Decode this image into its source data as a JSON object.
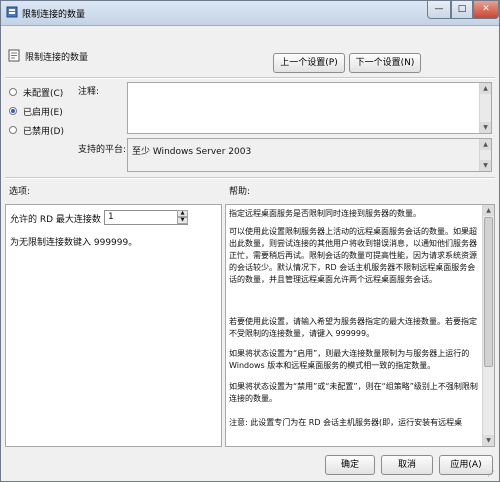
{
  "window": {
    "title": "限制连接的数量",
    "controls": {
      "minimize": "—",
      "maximize": "□",
      "close": "✕"
    }
  },
  "header": {
    "policy_title": "限制连接的数量",
    "prev_button": "上一个设置(P)",
    "next_button": "下一个设置(N)"
  },
  "options": {
    "not_configured": "未配置(C)",
    "enabled": "已启用(E)",
    "disabled": "已禁用(D)",
    "selected": "enabled"
  },
  "comment": {
    "label": "注释:",
    "value": ""
  },
  "platform": {
    "label": "支持的平台:",
    "value": "至少 Windows Server 2003"
  },
  "options_section": {
    "label": "选项:",
    "max_connections_label": "允许的 RD 最大连接数",
    "max_connections_value": "1",
    "unlimited_hint": "为无限制连接数键入 999999。"
  },
  "help_section": {
    "label": "帮助:",
    "paragraphs": [
      "指定远程桌面服务是否限制同时连接到服务器的数量。",
      "可以使用此设置限制服务器上活动的远程桌面服务会话的数量。如果超出此数量，则尝试连接的其他用户将收到错误消息，以通知他们服务器正忙，需要稍后再试。限制会话的数量可提高性能，因为请求系统资源的会话较少。默认情况下，RD 会话主机服务器不限制远程桌面服务会话的数量，并且管理远程桌面允许两个远程桌面服务会话。",
      "若要使用此设置，请输入希望为服务器指定的最大连接数量。若要指定不受限制的连接数量，请键入 999999。",
      "如果将状态设置为“启用”，则最大连接数量限制为与服务器上运行的 Windows 版本和远程桌面服务的模式相一致的指定数量。",
      "如果将状态设置为“禁用”或“未配置”，则在“组策略”级别上不强制限制连接的数量。",
      "注意: 此设置专门为在 RD 会话主机服务器(即，运行安装有远程桌"
    ]
  },
  "footer": {
    "ok": "确定",
    "cancel": "取消",
    "apply": "应用(A)"
  }
}
